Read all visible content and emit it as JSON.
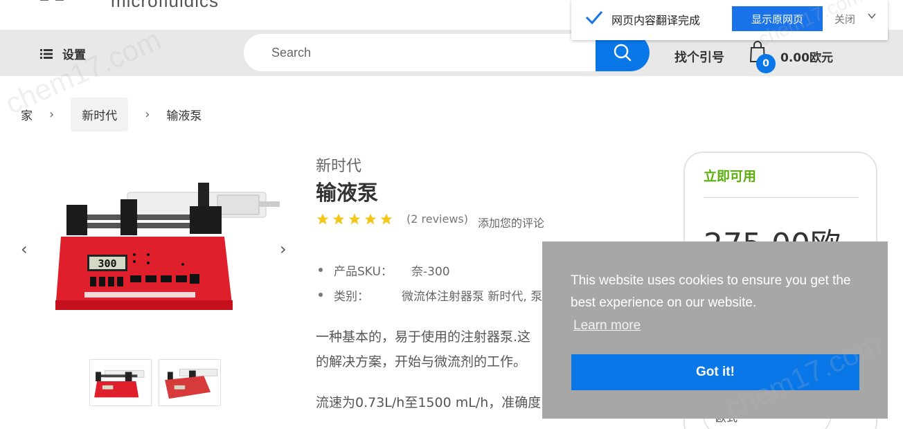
{
  "logo": {
    "text": "microfluidics"
  },
  "nav": {
    "menu_label": "设置",
    "search_placeholder": "Search",
    "quote_label": "找个引号",
    "cart_count": "0",
    "cart_total": "0.00欧元"
  },
  "translate_bar": {
    "message": "网页内容翻译完成",
    "show_original": "显示原网页",
    "close": "关闭"
  },
  "breadcrumb": {
    "items": [
      {
        "label": "家"
      },
      {
        "label": "新时代"
      },
      {
        "label": "输液泵"
      }
    ]
  },
  "product": {
    "brand": "新时代",
    "title": "输液泵",
    "rating": 5,
    "reviews": "(2 reviews)",
    "add_review": "添加您的评论",
    "specs": [
      {
        "label": "产品SKU：",
        "value": "奈-300"
      },
      {
        "label": "类别：",
        "value": "微流体注射器泵 新时代, 泵"
      }
    ],
    "description_line1": "一种基本的，易于使用的注射器泵.这",
    "description_line2": "的解决方案，开始与微流剂的工作。",
    "description_line3": "流速为0.73L/h至1500 mL/h，准确度",
    "display_value": "300"
  },
  "price_card": {
    "availability": "立即可用",
    "price": "275.00欧",
    "currency_label": "欧式"
  },
  "cookie": {
    "message": "This website uses cookies to ensure you get the best experience on our website.",
    "learn_more": "Learn more",
    "accept": "Got it!"
  },
  "watermark": "chem17.com",
  "colors": {
    "accent": "#0a77e8",
    "available": "#5aae0c",
    "navbar": "#e8e8e8",
    "cookie_bg": "#a8a7a7",
    "star": "#f5c518"
  }
}
